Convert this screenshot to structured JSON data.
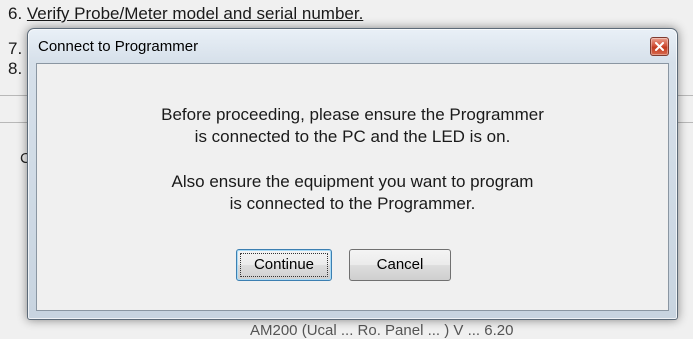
{
  "background": {
    "line6_prefix": "6. ",
    "line6_text": "Verify Probe/Meter model and serial number.",
    "line7_prefix": "7.",
    "line8_prefix": "8.",
    "partial_label": "C",
    "bottom_text": "AM200 (Ucal ... Ro. Panel ... ) V ... 6.20"
  },
  "dialog": {
    "title": "Connect to Programmer",
    "message_line1": "Before proceeding, please ensure the Programmer",
    "message_line2": "is connected to the PC and the LED is on.",
    "message_line3": "Also ensure the equipment you want to program",
    "message_line4": "is connected to the Programmer.",
    "continue_label": "Continue",
    "cancel_label": "Cancel"
  },
  "icons": {
    "close": "close-icon"
  },
  "colors": {
    "close_button": "#c94a2f",
    "default_button_border": "#3c7fb1",
    "title_bar": "#d6e0ea"
  }
}
